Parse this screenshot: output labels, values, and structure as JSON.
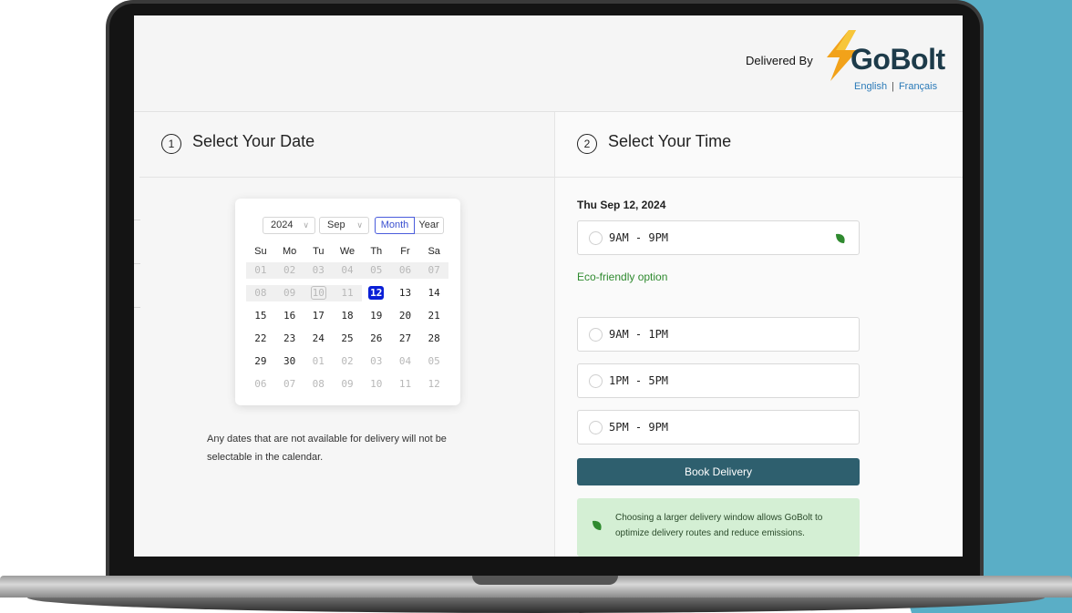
{
  "header": {
    "delivered_by": "Delivered By",
    "brand": "GoBolt",
    "lang_en": "English",
    "lang_fr": "Français"
  },
  "date_section": {
    "step": "1",
    "title": "Select Your Date",
    "calendar": {
      "year": "2024",
      "month": "Sep",
      "view_month": "Month",
      "view_year": "Year",
      "weekdays": [
        "Su",
        "Mo",
        "Tu",
        "We",
        "Th",
        "Fr",
        "Sa"
      ],
      "weeks": [
        [
          "01",
          "02",
          "03",
          "04",
          "05",
          "06",
          "07"
        ],
        [
          "08",
          "09",
          "10",
          "11",
          "12",
          "13",
          "14"
        ],
        [
          "15",
          "16",
          "17",
          "18",
          "19",
          "20",
          "21"
        ],
        [
          "22",
          "23",
          "24",
          "25",
          "26",
          "27",
          "28"
        ],
        [
          "29",
          "30",
          "01",
          "02",
          "03",
          "04",
          "05"
        ],
        [
          "06",
          "07",
          "08",
          "09",
          "10",
          "11",
          "12"
        ]
      ],
      "selected_day": "12",
      "today_day": "10"
    },
    "note": "Any dates that are not available for delivery will not be selectable in the calendar."
  },
  "time_section": {
    "step": "2",
    "title": "Select Your Time",
    "selected_date": "Thu Sep 12, 2024",
    "eco_slot": "9AM - 9PM",
    "eco_label": "Eco-friendly option",
    "slots": [
      "9AM - 1PM",
      "1PM - 5PM",
      "5PM - 9PM"
    ],
    "book_button": "Book Delivery",
    "info_text": "Choosing a larger delivery window allows GoBolt to optimize delivery routes and reduce emissions."
  },
  "colors": {
    "teal_background": "#5aaec6",
    "book_button": "#2e5f6e",
    "eco_green": "#2f8a2f",
    "selected_day": "#0a1fd6"
  }
}
